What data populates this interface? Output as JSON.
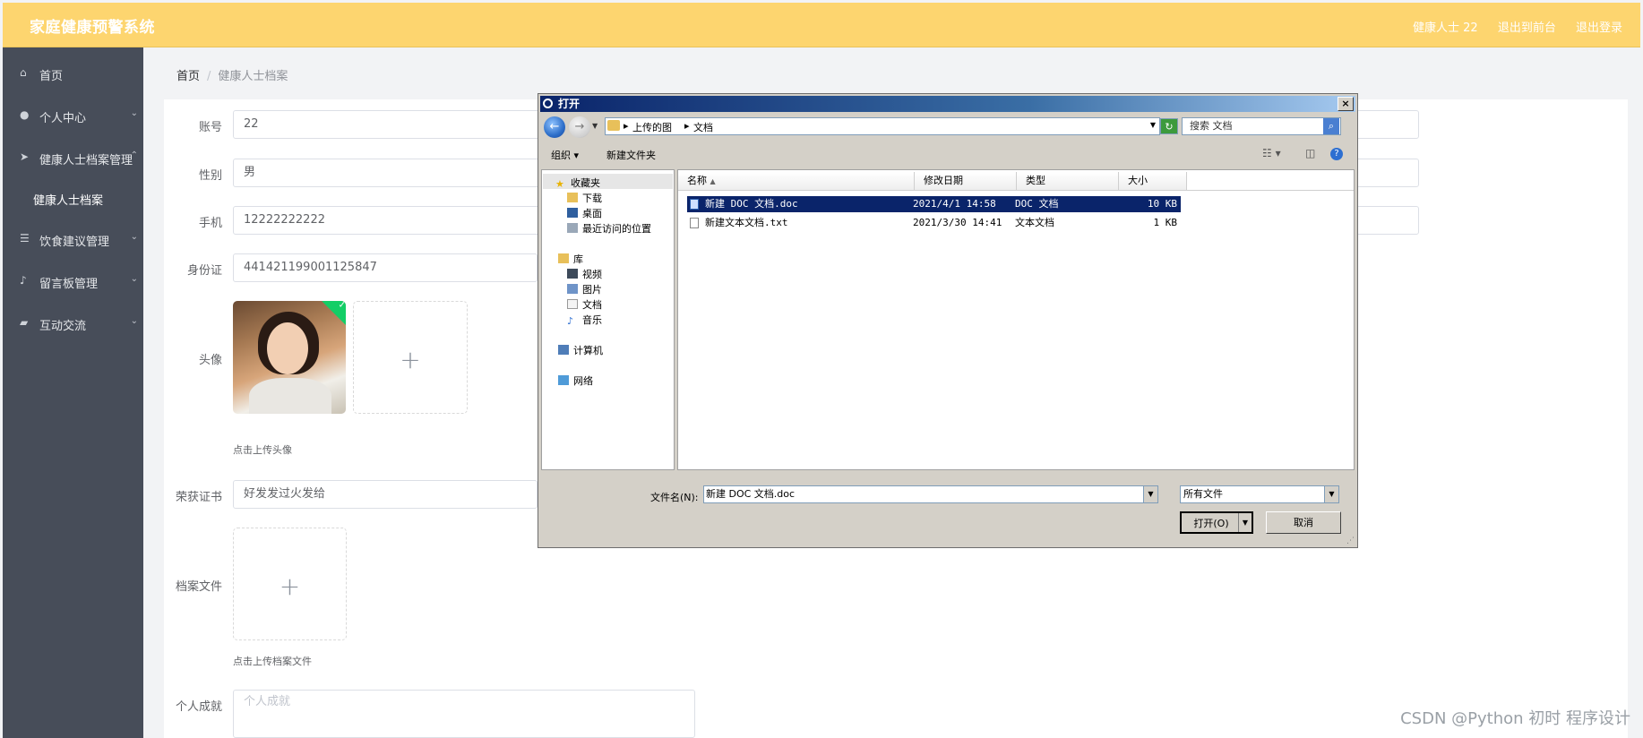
{
  "header": {
    "app_title": "家庭健康预警系统",
    "user_label": "健康人士 22",
    "to_frontend": "退出到前台",
    "logout": "退出登录"
  },
  "sidebar": {
    "items": [
      {
        "label": "首页",
        "icon": "home-icon"
      },
      {
        "label": "个人中心",
        "icon": "user-icon"
      },
      {
        "label": "健康人士档案管理",
        "icon": "send-icon"
      },
      {
        "label": "健康人士档案",
        "sub": true
      },
      {
        "label": "饮食建议管理",
        "icon": "sliders-icon"
      },
      {
        "label": "留言板管理",
        "icon": "mic-icon"
      },
      {
        "label": "互动交流",
        "icon": "chat-icon"
      }
    ]
  },
  "breadcrumb": {
    "home": "首页",
    "sep": "/",
    "current": "健康人士档案"
  },
  "form": {
    "account_label": "账号",
    "account_value": "22",
    "gender_label": "性别",
    "gender_value": "男",
    "phone_label": "手机",
    "phone_value": "12222222222",
    "idcard_label": "身份证",
    "idcard_value": "441421199001125847",
    "avatar_label": "头像",
    "avatar_hint": "点击上传头像",
    "award_label": "荣获证书",
    "award_value": "好发发过火发给",
    "file_label": "档案文件",
    "file_hint": "点击上传档案文件",
    "achievement_label": "个人成就",
    "achievement_placeholder": "个人成就"
  },
  "watermark": "CSDN @Python 初时 程序设计",
  "dialog": {
    "title": "打开",
    "close": "×",
    "path": [
      "上传的图",
      "文档"
    ],
    "search_placeholder": "搜索 文档",
    "toolbar": {
      "organize": "组织",
      "new_folder": "新建文件夹"
    },
    "nav_tree": {
      "favorites": "收藏夹",
      "favorites_items": [
        "下载",
        "桌面",
        "最近访问的位置"
      ],
      "libraries": "库",
      "library_items": [
        "视频",
        "图片",
        "文档",
        "音乐"
      ],
      "computer": "计算机",
      "network": "网络"
    },
    "columns": {
      "name": "名称",
      "modified": "修改日期",
      "type": "类型",
      "size": "大小"
    },
    "files": [
      {
        "name": "新建 DOC 文档.doc",
        "modified": "2021/4/1 14:58",
        "type": "DOC 文档",
        "size": "10 KB",
        "selected": true
      },
      {
        "name": "新建文本文档.txt",
        "modified": "2021/3/30 14:41",
        "type": "文本文档",
        "size": "1 KB",
        "selected": false
      }
    ],
    "filename_label": "文件名(N):",
    "filename_value": "新建 DOC 文档.doc",
    "filetype_value": "所有文件",
    "open_button": "打开(O)",
    "cancel_button": "取消"
  }
}
